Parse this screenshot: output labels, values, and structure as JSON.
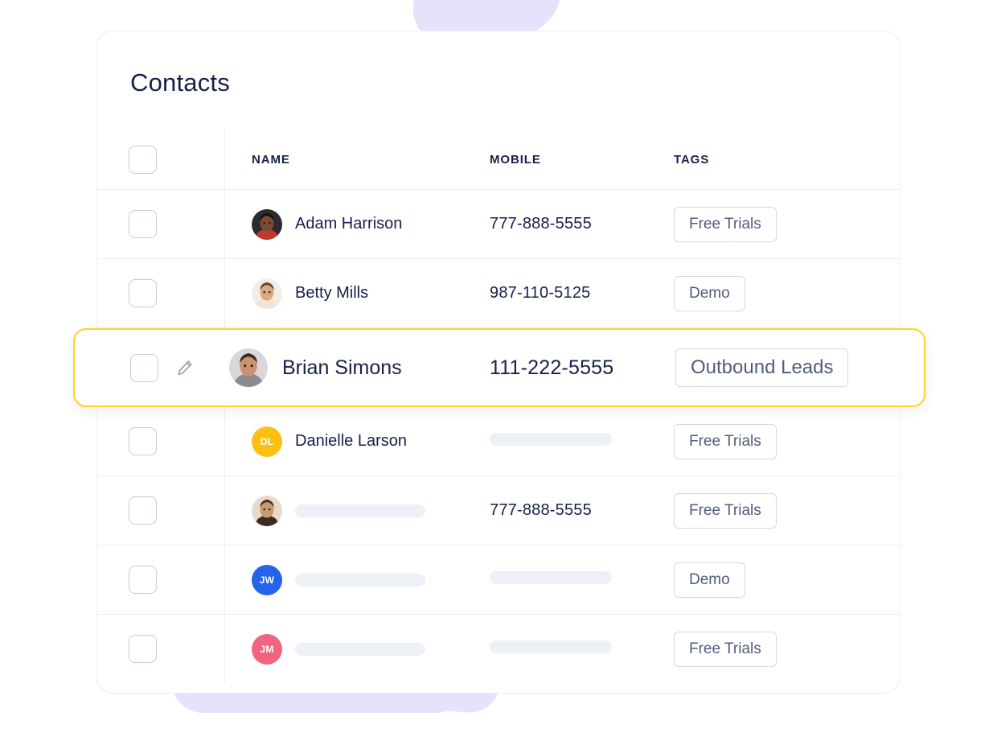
{
  "page": {
    "title": "Contacts",
    "accent_highlight": "#FFD426",
    "text_color": "#16204A",
    "blob_color": "#E6E2FC"
  },
  "table": {
    "headers": {
      "select_all": "",
      "name": "NAME",
      "mobile": "MOBILE",
      "tags": "TAGS"
    },
    "rows": [
      {
        "avatar_type": "photo",
        "avatar_initials": "",
        "avatar_color": "#6B4A3A",
        "name": "Adam Harrison",
        "name_masked": false,
        "mobile": "777-888-5555",
        "mobile_masked": false,
        "tag": "Free Trials",
        "highlighted": false,
        "editable": false
      },
      {
        "avatar_type": "photo",
        "avatar_initials": "",
        "avatar_color": "#C8A080",
        "name": "Betty Mills",
        "name_masked": false,
        "mobile": "987-110-5125",
        "mobile_masked": false,
        "tag": "Demo",
        "highlighted": false,
        "editable": false
      },
      {
        "avatar_type": "photo",
        "avatar_initials": "",
        "avatar_color": "#9AA0A6",
        "name": "Brian Simons",
        "name_masked": false,
        "mobile": "111-222-5555",
        "mobile_masked": false,
        "tag": "Outbound Leads",
        "highlighted": true,
        "editable": true
      },
      {
        "avatar_type": "initials",
        "avatar_initials": "DL",
        "avatar_color": "#FCBF13",
        "name": "Danielle Larson",
        "name_masked": false,
        "mobile": "",
        "mobile_masked": true,
        "tag": "Free Trials",
        "highlighted": false,
        "editable": false
      },
      {
        "avatar_type": "photo",
        "avatar_initials": "",
        "avatar_color": "#B08A66",
        "name": "",
        "name_masked": true,
        "mobile": "777-888-5555",
        "mobile_masked": false,
        "tag": "Free Trials",
        "highlighted": false,
        "editable": false
      },
      {
        "avatar_type": "initials",
        "avatar_initials": "JW",
        "avatar_color": "#2563EB",
        "name": "",
        "name_masked": true,
        "mobile": "",
        "mobile_masked": true,
        "tag": "Demo",
        "highlighted": false,
        "editable": false
      },
      {
        "avatar_type": "initials",
        "avatar_initials": "JM",
        "avatar_color": "#F2637F",
        "name": "",
        "name_masked": true,
        "mobile": "",
        "mobile_masked": true,
        "tag": "Free Trials",
        "highlighted": false,
        "editable": false
      }
    ]
  },
  "icons": {
    "edit": "pencil-icon",
    "checkbox": "checkbox-icon"
  }
}
